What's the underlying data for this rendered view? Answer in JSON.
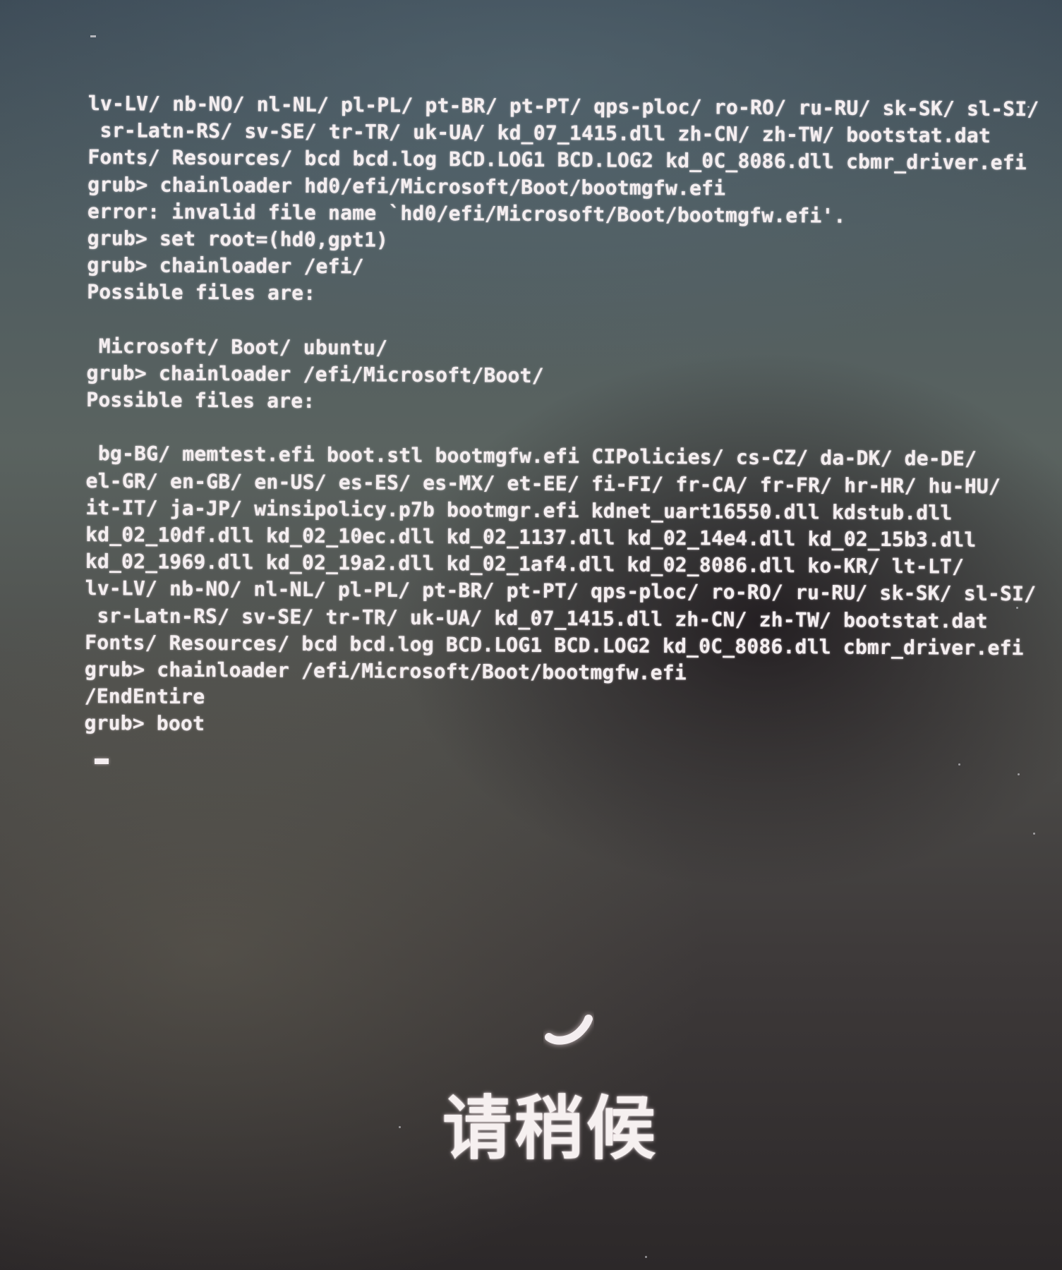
{
  "terminal": {
    "lines": [
      "lv-LV/ nb-NO/ nl-NL/ pl-PL/ pt-BR/ pt-PT/ qps-ploc/ ro-RO/ ru-RU/ sk-SK/ sl-SI/",
      " sr-Latn-RS/ sv-SE/ tr-TR/ uk-UA/ kd_07_1415.dll zh-CN/ zh-TW/ bootstat.dat",
      "Fonts/ Resources/ bcd bcd.log BCD.LOG1 BCD.LOG2 kd_0C_8086.dll cbmr_driver.efi",
      "grub> chainloader hd0/efi/Microsoft/Boot/bootmgfw.efi",
      "error: invalid file name `hd0/efi/Microsoft/Boot/bootmgfw.efi'.",
      "grub> set root=(hd0,gpt1)",
      "grub> chainloader /efi/",
      "Possible files are:",
      "",
      " Microsoft/ Boot/ ubuntu/",
      "grub> chainloader /efi/Microsoft/Boot/",
      "Possible files are:",
      "",
      " bg-BG/ memtest.efi boot.stl bootmgfw.efi CIPolicies/ cs-CZ/ da-DK/ de-DE/",
      "el-GR/ en-GB/ en-US/ es-ES/ es-MX/ et-EE/ fi-FI/ fr-CA/ fr-FR/ hr-HR/ hu-HU/",
      "it-IT/ ja-JP/ winsipolicy.p7b bootmgr.efi kdnet_uart16550.dll kdstub.dll",
      "kd_02_10df.dll kd_02_10ec.dll kd_02_1137.dll kd_02_14e4.dll kd_02_15b3.dll",
      "kd_02_1969.dll kd_02_19a2.dll kd_02_1af4.dll kd_02_8086.dll ko-KR/ lt-LT/",
      "lv-LV/ nb-NO/ nl-NL/ pl-PL/ pt-BR/ pt-PT/ qps-ploc/ ro-RO/ ru-RU/ sk-SK/ sl-SI/",
      " sr-Latn-RS/ sv-SE/ tr-TR/ uk-UA/ kd_07_1415.dll zh-CN/ zh-TW/ bootstat.dat",
      "Fonts/ Resources/ bcd bcd.log BCD.LOG1 BCD.LOG2 kd_0C_8086.dll cbmr_driver.efi",
      "grub> chainloader /efi/Microsoft/Boot/bootmgfw.efi",
      "/EndEntire",
      "grub> boot"
    ]
  },
  "boot_screen": {
    "spinner_icon": "loading-spinner-icon",
    "wait_text": "请稍候"
  },
  "colors": {
    "text": "#f4eef0",
    "background_top": "#3c4a56",
    "background_bottom": "#2c2829"
  }
}
